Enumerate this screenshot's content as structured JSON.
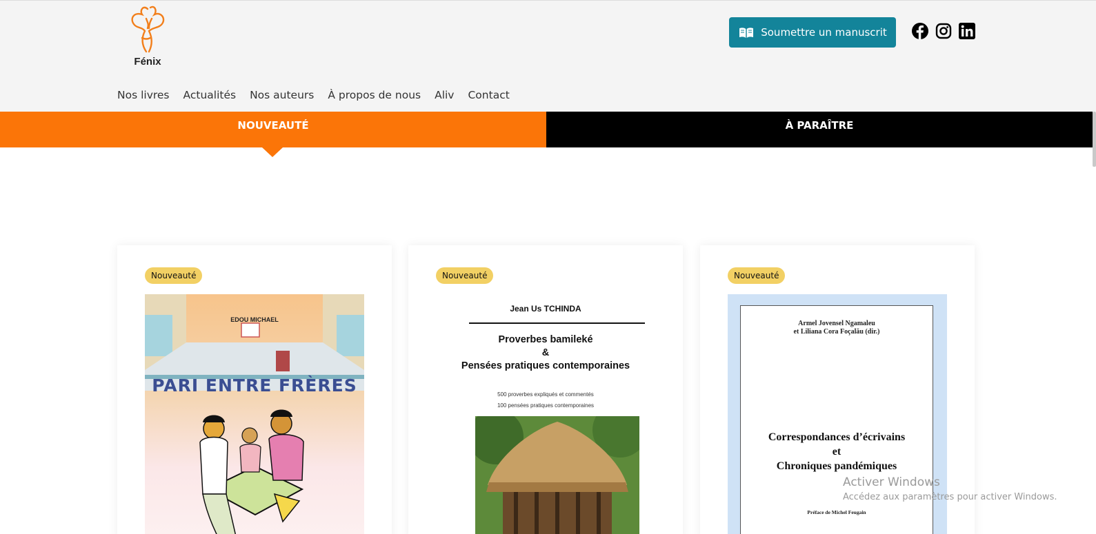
{
  "logo": {
    "text": "Fénix",
    "icon": "phoenix-logo-icon",
    "color": "#f27f1b"
  },
  "nav": {
    "items": [
      {
        "label": "Nos livres"
      },
      {
        "label": "Actualités"
      },
      {
        "label": "Nos auteurs"
      },
      {
        "label": "À propos de nous"
      },
      {
        "label": "Aliv"
      },
      {
        "label": "Contact"
      }
    ]
  },
  "header": {
    "submit_label": "Soumettre un manuscrit",
    "submit_color": "#13849a",
    "socials": [
      "facebook-icon",
      "instagram-icon",
      "linkedin-icon"
    ]
  },
  "tabs": {
    "active": "NOUVEAUTÉ",
    "inactive": "À PARAÎTRE",
    "active_color": "#fb7508",
    "inactive_color": "#000000"
  },
  "books": [
    {
      "badge": "Nouveauté",
      "author": "EDOU MICHAEL",
      "title": "PARI ENTRE FRÈRES"
    },
    {
      "badge": "Nouveauté",
      "author": "Jean Us TCHINDA",
      "title_line1": "Proverbes bamileké",
      "title_line2": "&",
      "title_line3": "Pensées pratiques contemporaines",
      "sub1": "500 proverbes expliqués et commentés",
      "sub2": "100 pensées pratiques contemporaines"
    },
    {
      "badge": "Nouveauté",
      "author1": "Armel Jovensel Ngamaleu",
      "author2": "et Liliana Cora Foçalău (dir.)",
      "title_line1": "Correspondances d’écrivains",
      "title_line2": "et",
      "title_line3": "Chroniques pandémiques",
      "preface": "Préface de Michel Feugain"
    }
  ],
  "watermark": {
    "title": "Activer Windows",
    "subtitle": "Accédez aux paramètres pour activer Windows."
  }
}
